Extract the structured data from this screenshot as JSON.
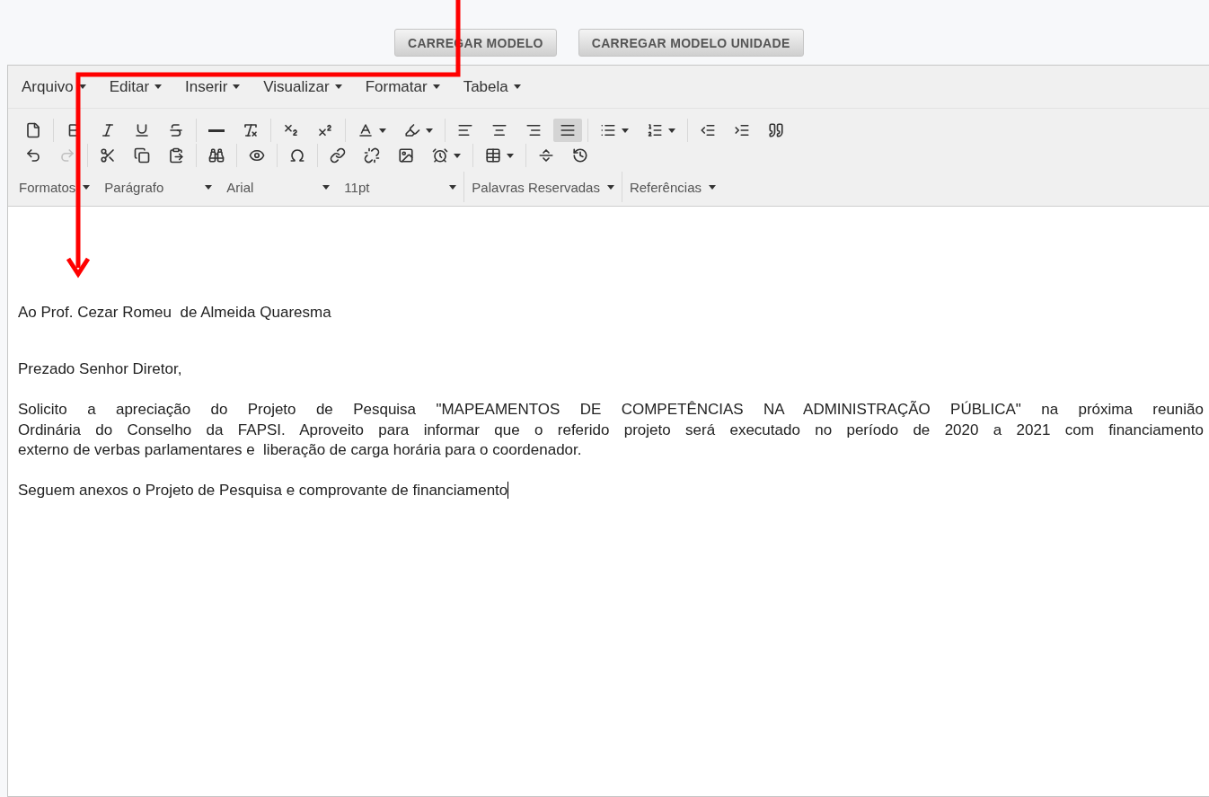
{
  "top_buttons": [
    "CARREGAR MODELO",
    "CARREGAR MODELO UNIDADE"
  ],
  "menu": [
    "Arquivo",
    "Editar",
    "Inserir",
    "Visualizar",
    "Formatar",
    "Tabela"
  ],
  "toolbar_rows": [
    [
      [
        {
          "selected": false,
          "disabled": false
        }
      ],
      [
        {
          "selected": false,
          "disabled": false
        },
        {
          "selected": false,
          "disabled": false
        },
        {
          "selected": false,
          "disabled": false
        },
        {
          "selected": false,
          "disabled": false
        }
      ],
      [
        {
          "selected": false,
          "disabled": false
        },
        {
          "selected": false,
          "disabled": false
        }
      ],
      [
        {
          "selected": false,
          "disabled": false
        },
        {
          "selected": false,
          "disabled": false
        }
      ],
      [
        {
          "selected": false,
          "disabled": false
        },
        {
          "selected": false,
          "disabled": false
        }
      ],
      [
        {
          "selected": false,
          "disabled": false
        },
        {
          "selected": false,
          "disabled": false
        },
        {
          "selected": false,
          "disabled": false
        },
        {
          "selected": true,
          "disabled": false
        }
      ],
      [
        {
          "selected": false,
          "disabled": false
        },
        {
          "selected": false,
          "disabled": false
        }
      ],
      [
        {
          "selected": false,
          "disabled": false
        },
        {
          "selected": false,
          "disabled": false
        },
        {
          "selected": false,
          "disabled": false
        }
      ]
    ],
    [
      [
        {
          "selected": false,
          "disabled": false
        },
        {
          "selected": false,
          "disabled": true
        }
      ],
      [
        {
          "selected": false,
          "disabled": false
        },
        {
          "selected": false,
          "disabled": false
        },
        {
          "selected": false,
          "disabled": false
        }
      ],
      [
        {
          "selected": false,
          "disabled": false
        }
      ],
      [
        {
          "selected": false,
          "disabled": false
        }
      ],
      [
        {
          "selected": false,
          "disabled": false
        }
      ],
      [
        {
          "selected": false,
          "disabled": false
        },
        {
          "selected": false,
          "disabled": false
        },
        {
          "selected": false,
          "disabled": false
        },
        {
          "selected": false,
          "disabled": false
        }
      ],
      [
        {
          "selected": false,
          "disabled": false
        }
      ],
      [
        {
          "selected": false,
          "disabled": false
        },
        {
          "selected": false,
          "disabled": false
        }
      ]
    ]
  ],
  "format_groups": [
    [
      "Formatos",
      "Parágrafo",
      "Arial",
      "11pt"
    ],
    [
      "Palavras Reservadas"
    ],
    [
      "Referências"
    ]
  ],
  "document": [
    "Ao Prof. Cezar Romeu  de Almeida Quaresma",
    "Prezado Senhor Diretor,",
    [
      "Solicito a apreciação do Projeto de Pesquisa \"MAPEAMENTOS DE COMPETÊNCIAS NA ADMINISTRAÇÃO PÚBLICA\" na próxima reunião",
      "Ordinária do Conselho da FAPSI. Aproveito para informar que o referido projeto será executado no período de 2020 a 2021 com financiamento",
      "externo de verbas parlamentares e  liberação de carga horária para o coordenador."
    ],
    "Seguem anexos o Projeto de Pesquisa e comprovante de financiamento"
  ]
}
